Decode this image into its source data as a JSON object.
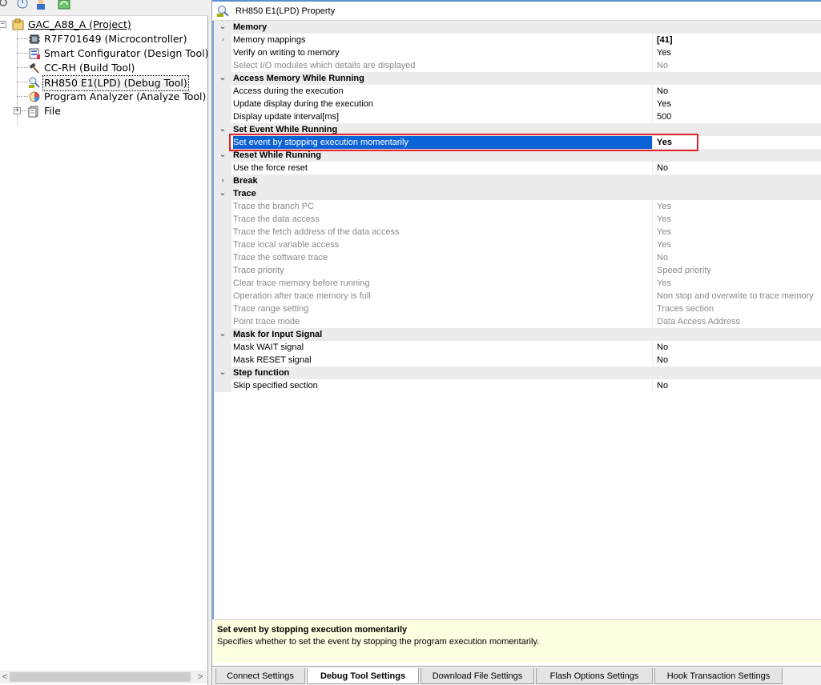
{
  "tree": {
    "project": "GAC_A88_A (Project)",
    "microcontroller": "R7F701649 (Microcontroller)",
    "smart_configurator": "Smart Configurator (Design Tool)",
    "build_tool": "CC-RH (Build Tool)",
    "debug_tool": "RH850 E1(LPD) (Debug Tool)",
    "analyze_tool": "Program Analyzer (Analyze Tool)",
    "file": "File",
    "collapse_glyph": "−",
    "expand_glyph": "+"
  },
  "scrollbar": {
    "left_arrow": "<",
    "right_arrow": ">"
  },
  "panel": {
    "title": "RH850 E1(LPD) Property"
  },
  "glyphs": {
    "collapsed": "›",
    "expanded": "⌄"
  },
  "grid": {
    "rows": [
      {
        "kind": "cat",
        "state": "expanded",
        "name": "Memory",
        "value": ""
      },
      {
        "kind": "prop",
        "state": "collapsed",
        "name": "Memory mappings",
        "value": "[41]",
        "bold_value": true
      },
      {
        "kind": "prop",
        "name": "Verify on writing to memory",
        "value": "Yes"
      },
      {
        "kind": "prop",
        "name": "Select I/O modules which details are displayed",
        "value": "No",
        "disabled": true
      },
      {
        "kind": "cat",
        "state": "expanded",
        "name": "Access Memory While Running",
        "value": ""
      },
      {
        "kind": "prop",
        "name": "Access during the execution",
        "value": "No"
      },
      {
        "kind": "prop",
        "name": "Update display during the execution",
        "value": "Yes"
      },
      {
        "kind": "prop",
        "name": "Display update interval[ms]",
        "value": "500"
      },
      {
        "kind": "cat",
        "state": "expanded",
        "name": "Set Event While Running",
        "value": ""
      },
      {
        "kind": "prop",
        "name": "Set event by stopping execution momentarily",
        "value": "Yes",
        "selected": true
      },
      {
        "kind": "cat",
        "state": "expanded",
        "name": "Reset While Running",
        "value": ""
      },
      {
        "kind": "prop",
        "name": "Use the force reset",
        "value": "No"
      },
      {
        "kind": "cat",
        "state": "collapsed",
        "name": "Break",
        "value": ""
      },
      {
        "kind": "cat",
        "state": "expanded",
        "name": "Trace",
        "value": ""
      },
      {
        "kind": "prop",
        "name": "Trace the branch PC",
        "value": "Yes",
        "disabled": true
      },
      {
        "kind": "prop",
        "name": "Trace the data access",
        "value": "Yes",
        "disabled": true
      },
      {
        "kind": "prop",
        "name": "Trace the fetch address of the data access",
        "value": "Yes",
        "disabled": true
      },
      {
        "kind": "prop",
        "name": "Trace local variable access",
        "value": "Yes",
        "disabled": true
      },
      {
        "kind": "prop",
        "name": "Trace the software trace",
        "value": "No",
        "disabled": true
      },
      {
        "kind": "prop",
        "name": "Trace priority",
        "value": "Speed priority",
        "disabled": true
      },
      {
        "kind": "prop",
        "name": "Clear trace memory before running",
        "value": "Yes",
        "disabled": true
      },
      {
        "kind": "prop",
        "name": "Operation after trace memory is full",
        "value": "Non stop and overwrite to trace memory",
        "disabled": true
      },
      {
        "kind": "prop",
        "name": "Trace range setting",
        "value": "Traces section",
        "disabled": true
      },
      {
        "kind": "prop",
        "name": "Point trace mode",
        "value": "Data Access Address",
        "disabled": true
      },
      {
        "kind": "cat",
        "state": "expanded",
        "name": "Mask for Input Signal",
        "value": ""
      },
      {
        "kind": "prop",
        "name": "Mask WAIT signal",
        "value": "No"
      },
      {
        "kind": "prop",
        "name": "Mask RESET signal",
        "value": "No"
      },
      {
        "kind": "cat",
        "state": "expanded",
        "name": "Step function",
        "value": ""
      },
      {
        "kind": "prop",
        "name": "Skip specified section",
        "value": "No"
      }
    ]
  },
  "description": {
    "title": "Set event by stopping execution momentarily",
    "text": "Specifies whether to set the event by stopping the program execution momentarily."
  },
  "tabs": [
    {
      "label": "Connect Settings",
      "active": false
    },
    {
      "label": "Debug Tool Settings",
      "active": true
    },
    {
      "label": "Download File Settings",
      "active": false
    },
    {
      "label": "Flash Options Settings",
      "active": false
    },
    {
      "label": "Hook Transaction Settings",
      "active": false
    }
  ],
  "colors": {
    "selection": "#0a63d6",
    "highlight_box": "#e2222a",
    "description_bg": "#ffffe1"
  }
}
